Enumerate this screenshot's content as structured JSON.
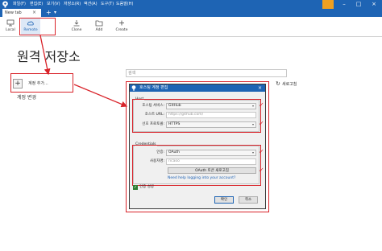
{
  "menu": {
    "items": [
      "파일(F)",
      "편집(E)",
      "보기(V)",
      "저장소(R)",
      "액션(A)",
      "도구(T)",
      "도움말(H)"
    ]
  },
  "tabs": {
    "active_label": "New tab",
    "close_glyph": "×",
    "add_glyph": "+",
    "dropdown_glyph": "▾"
  },
  "toolbar": {
    "local_label": "Local",
    "remote_label": "Remote",
    "clone_label": "Clone",
    "add_label": "Add",
    "create_label": "Create"
  },
  "main": {
    "title": "원격 저장소",
    "add_account_glyph": "+",
    "add_account_label": "계정 추가...",
    "change_account_label": "계정 변경",
    "search_placeholder": "검색",
    "refresh_label": "새로고침"
  },
  "dialog": {
    "title": "호스팅 계정 편집",
    "close_glyph": "×",
    "host_group_label": "Host",
    "hosting_service_label": "호스팅 서비스:",
    "hosting_service_value": "GitHub",
    "host_url_label": "호스트 URL:",
    "host_url_placeholder": "https://github.com/",
    "preferred_protocol_label": "선호 프로토콜:",
    "preferred_protocol_value": "HTTPS",
    "credentials_group_label": "Credentials",
    "auth_label": "인증:",
    "auth_value": "OAuth",
    "username_label": "사용자명:",
    "username_value": "ricaoo",
    "refresh_token_button": "OAuth 토큰 새로고침",
    "help_link": "Need help logging into your account?",
    "auth_success_label": "인증 성공",
    "ok_button": "확인",
    "cancel_button": "취소"
  },
  "icons": {
    "app_logo": "sourcetree-logo-icon",
    "local": "monitor-icon",
    "remote": "cloud-icon",
    "clone": "download-icon",
    "add": "folder-icon",
    "create": "plus-icon",
    "refresh": "refresh-icon",
    "check": "check-icon",
    "arrow_glyph": "▾",
    "refresh_glyph": "↻",
    "check_glyph": "✓",
    "red_check_glyph": "✓"
  },
  "colors": {
    "brand_blue": "#1e64b4",
    "annotation_red": "#d9232a",
    "success_green": "#2e7d32",
    "link_blue": "#1a5fb4"
  }
}
